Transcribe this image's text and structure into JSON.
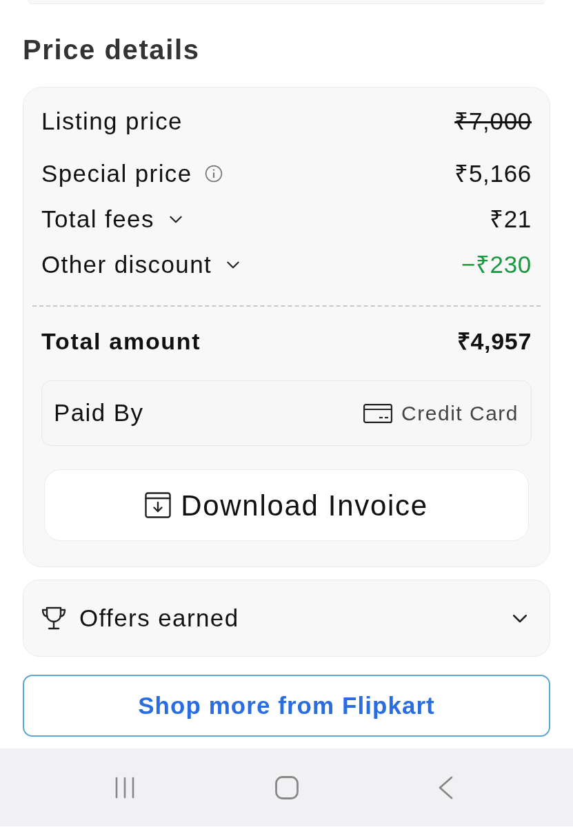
{
  "heading": "Price details",
  "price_rows": [
    {
      "label": "Listing price",
      "kind": "plain",
      "value": "₹7,000",
      "strikethrough": true,
      "color": "#111111"
    },
    {
      "label": "Special price",
      "kind": "info",
      "value": "₹5,166",
      "strikethrough": false,
      "color": "#111111"
    },
    {
      "label": "Total fees",
      "kind": "expandable",
      "expanded": false,
      "value": "₹21",
      "strikethrough": false,
      "color": "#111111"
    },
    {
      "label": "Other discount",
      "kind": "expandable",
      "expanded": false,
      "value": "−₹230",
      "strikethrough": false,
      "color": "#1a9a3f"
    }
  ],
  "total": {
    "label": "Total amount",
    "value": "₹4,957"
  },
  "payment": {
    "label": "Paid By",
    "method": "Credit Card"
  },
  "download_button": "Download Invoice",
  "offers": {
    "label": "Offers earned",
    "expanded": false
  },
  "shop_button": "Shop more from Flipkart"
}
